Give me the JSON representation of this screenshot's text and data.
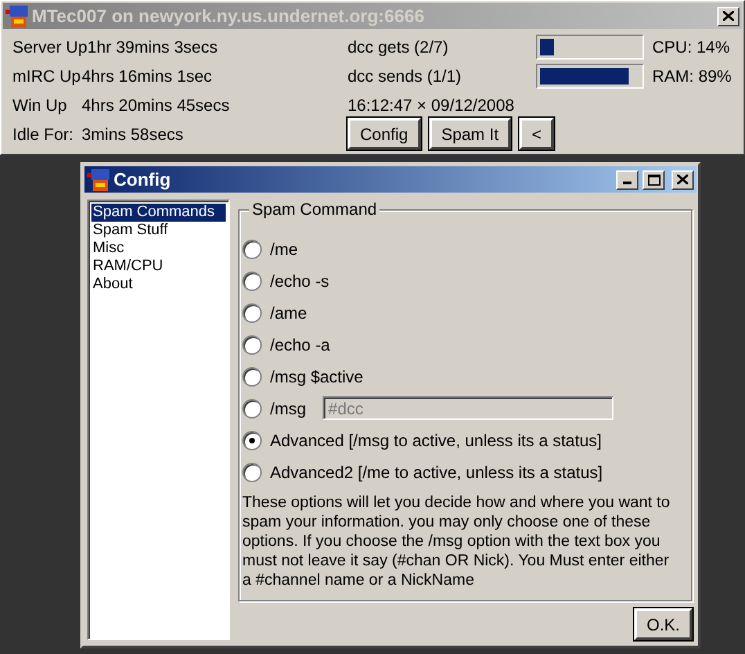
{
  "main_window": {
    "title": "MTec007 on newyork.ny.us.undernet.org:6666",
    "stats": [
      {
        "label": "Server Up",
        "value": "1hr 39mins 3secs"
      },
      {
        "label": "mIRC Up",
        "value": "4hrs 16mins 1sec"
      },
      {
        "label": "Win Up",
        "value": "4hrs 20mins 45secs"
      },
      {
        "label": "Idle For:",
        "value": "3mins 58secs"
      }
    ],
    "dcc": [
      "dcc gets (2/7)",
      "dcc sends (1/1)"
    ],
    "datetime": "16:12:47 × 09/12/2008",
    "meters": [
      {
        "level": 0.14,
        "reading": "CPU: 14%"
      },
      {
        "level": 0.89,
        "reading": "RAM: 89%"
      }
    ],
    "buttons": [
      "Config",
      "Spam It",
      "<"
    ]
  },
  "config_window": {
    "title": "Config",
    "nav": [
      {
        "label": "Spam Commands",
        "selected": true
      },
      {
        "label": "Spam Stuff",
        "selected": false
      },
      {
        "label": "Misc",
        "selected": false
      },
      {
        "label": "RAM/CPU",
        "selected": false
      },
      {
        "label": "About",
        "selected": false
      }
    ],
    "group_title": "Spam Command",
    "options": [
      {
        "label": "/me",
        "selected": false
      },
      {
        "label": "/echo -s",
        "selected": false
      },
      {
        "label": "/ame",
        "selected": false
      },
      {
        "label": "/echo -a",
        "selected": false
      },
      {
        "label": "/msg $active",
        "selected": false
      },
      {
        "label": "/msg",
        "selected": false,
        "field": {
          "value": "#dcc",
          "disabled": true
        }
      },
      {
        "label": "Advanced [/msg to active, unless its a status]",
        "selected": true
      },
      {
        "label": "Advanced2 [/me to active, unless its a status]",
        "selected": false
      }
    ],
    "description": "These options will let you decide how and where you want to spam your information. you may only choose one of these options. If you choose the /msg option with the text box you must not leave it say (#chan OR Nick). You Must enter either a #channel name or a NickName",
    "ok_button": "O.K."
  }
}
